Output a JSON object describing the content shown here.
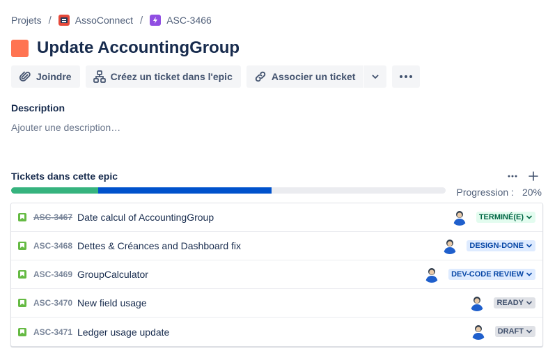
{
  "breadcrumb": {
    "items": [
      {
        "label": "Projets",
        "icon": ""
      },
      {
        "label": "AssoConnect",
        "icon": "project-icon"
      },
      {
        "label": "ASC-3466",
        "icon": "epic-icon"
      }
    ],
    "separator": "/"
  },
  "issue": {
    "title": "Update AccountingGroup",
    "type_icon": "epic-issue-type-icon",
    "type_color": "#FF7452"
  },
  "toolbar": {
    "attach_label": "Joindre",
    "create_child_label": "Créez un ticket dans l'epic",
    "link_label": "Associer un ticket"
  },
  "description": {
    "label": "Description",
    "placeholder": "Ajouter une description…"
  },
  "epic_tickets": {
    "title": "Tickets dans cette epic",
    "progress_label": "Progression :",
    "progress_percent": "20%",
    "progress_segments": [
      {
        "status": "done",
        "fraction": 0.2,
        "color": "#36B37E"
      },
      {
        "status": "in-progress",
        "fraction": 0.4,
        "color": "#0052CC"
      },
      {
        "status": "todo",
        "fraction": 0.4,
        "color": "#EBECF0"
      }
    ],
    "tickets": [
      {
        "key": "ASC-3467",
        "summary": "Date calcul of AccountingGroup",
        "status": "TERMINÉ(E)",
        "status_type": "done",
        "done": true
      },
      {
        "key": "ASC-3468",
        "summary": "Dettes & Créances and Dashboard fix",
        "status": "DESIGN-DONE",
        "status_type": "blue",
        "done": false
      },
      {
        "key": "ASC-3469",
        "summary": "GroupCalculator",
        "status": "DEV-CODE REVIEW",
        "status_type": "blue",
        "done": false
      },
      {
        "key": "ASC-3470",
        "summary": "New field usage",
        "status": "READY",
        "status_type": "grey",
        "done": false
      },
      {
        "key": "ASC-3471",
        "summary": "Ledger usage update",
        "status": "DRAFT",
        "status_type": "grey",
        "done": false
      }
    ]
  },
  "colors": {
    "done_green": "#36B37E",
    "in_progress_blue": "#0052CC",
    "text_primary": "#172B4D"
  }
}
